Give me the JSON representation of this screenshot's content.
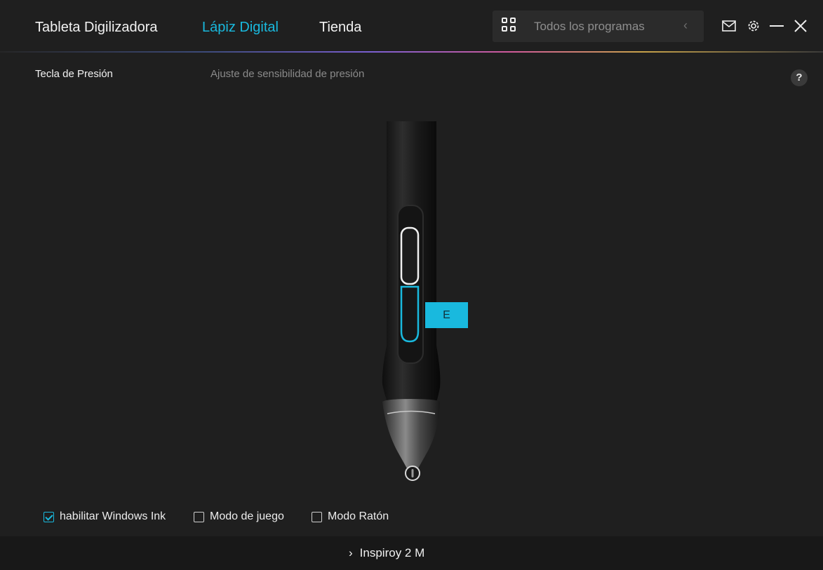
{
  "header": {
    "tabs": [
      {
        "label": "Tableta Digilizadora",
        "active": false
      },
      {
        "label": "Lápiz Digital",
        "active": true
      },
      {
        "label": "Tienda",
        "active": false
      }
    ],
    "programs": {
      "label": "Todos los programas",
      "icon": "grid-icon",
      "back_icon": "chevron-left-icon"
    },
    "window_icons": [
      "mail-icon",
      "gear-icon",
      "minimize-icon",
      "close-icon"
    ],
    "accent_color": "#19b9de"
  },
  "section": {
    "title": "Tecla de Presión",
    "subtitle": "Ajuste de sensibilidad de presión",
    "help_label": "?"
  },
  "pen": {
    "selected_key_label": "E",
    "selected_key_color": "#19b9de"
  },
  "options": [
    {
      "label": "habilitar Windows Ink",
      "checked": true
    },
    {
      "label": "Modo de juego",
      "checked": false
    },
    {
      "label": "Modo Ratón",
      "checked": false
    }
  ],
  "footer": {
    "device_name": "Inspiroy 2 M",
    "chevron_icon": "chevron-right-icon"
  }
}
